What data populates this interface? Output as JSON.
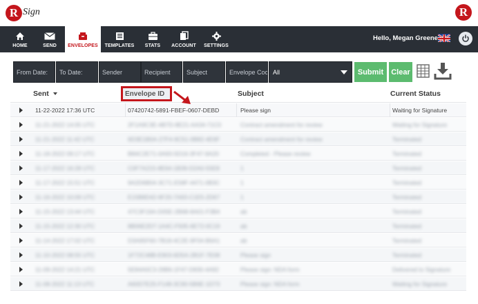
{
  "brand": {
    "logo_letter": "R",
    "logo_text": "Sign",
    "color": "#c4161c"
  },
  "nav": {
    "items": [
      {
        "label": "HOME",
        "icon": "home-icon"
      },
      {
        "label": "SEND",
        "icon": "envelope-icon"
      },
      {
        "label": "ENVELOPES",
        "icon": "envelopes-icon"
      },
      {
        "label": "TEMPLATES",
        "icon": "templates-icon"
      },
      {
        "label": "STATS",
        "icon": "briefcase-icon"
      },
      {
        "label": "ACCOUNT",
        "icon": "account-icon"
      },
      {
        "label": "SETTINGS",
        "icon": "gear-icon"
      }
    ],
    "active": "ENVELOPES",
    "greeting": "Hello, Megan Greene"
  },
  "filters": {
    "from_date": "From Date:",
    "to_date": "To Date:",
    "sender": "Sender",
    "recipient": "Recipient",
    "subject": "Subject",
    "envelope_code": "Envelope Coc",
    "status_select": "All",
    "submit": "Submit",
    "clear": "Clear"
  },
  "table": {
    "columns": {
      "sent": "Sent",
      "envelope_id": "Envelope ID",
      "subject": "Subject",
      "status": "Current Status"
    },
    "first_row": {
      "sent": "11-22-2022 17:36 UTC",
      "envelope_id": "07420742-5891-FBEF-0607-DEBD",
      "subject": "Please sign",
      "status": "Waiting for Signature"
    },
    "blurred_rows": [
      {
        "sent": "11-21-2022 14:05 UTC",
        "envelope_id": "2F1A9C3E-4B7D-8E21-AA34-71C0",
        "subject": "Contract amendment for review",
        "status": "Waiting for Signature"
      },
      {
        "sent": "11-21-2022 11:42 UTC",
        "envelope_id": "6D3E1B0A-27F4-9C51-0B82-4E6F",
        "subject": "Contract amendment for review",
        "status": "Terminated"
      },
      {
        "sent": "11-18-2022 09:17 UTC",
        "envelope_id": "B84C2E71-0A93-5D16-3F47-9A20",
        "subject": "Completed - Please review",
        "status": "Terminated"
      },
      {
        "sent": "11-17-2022 16:28 UTC",
        "envelope_id": "C0F7A215-8E64-1B39-D2A0-55E8",
        "subject": "1",
        "status": "Terminated"
      },
      {
        "sent": "11-17-2022 15:51 UTC",
        "envelope_id": "9A2D6B04-3C71-E58F-4471-0B3C",
        "subject": "1",
        "status": "Terminated"
      },
      {
        "sent": "11-16-2022 10:09 UTC",
        "envelope_id": "E15B8D42-6F20-7A93-C1E5-2D67",
        "subject": "1",
        "status": "Terminated"
      },
      {
        "sent": "11-15-2022 13:44 UTC",
        "envelope_id": "47C3F19A-D05E-2B68-8A01-F3B4",
        "subject": "ab",
        "status": "Terminated"
      },
      {
        "sent": "11-15-2022 12:30 UTC",
        "envelope_id": "8B06E2D7-1A4C-F935-6E72-0C19",
        "subject": "ab",
        "status": "Terminated"
      },
      {
        "sent": "11-14-2022 17:02 UTC",
        "envelope_id": "D3A95F60-7B18-4C2E-9F04-B6A1",
        "subject": "ab",
        "status": "Terminated"
      },
      {
        "sent": "11-10-2022 08:55 UTC",
        "envelope_id": "1F72C48B-E903-6D5A-2B1F-7E08",
        "subject": "Please sign",
        "status": "Terminated"
      },
      {
        "sent": "11-09-2022 14:21 UTC",
        "envelope_id": "5E84A0C3-29B6-1F47-D830-4A92",
        "subject": "Please sign: NDA form",
        "status": "Delivered to Signature"
      },
      {
        "sent": "11-08-2022 11:13 UTC",
        "envelope_id": "A60D7E25-F148-3C90-5B6E-1D73",
        "subject": "Please sign: NDA form",
        "status": "Waiting for Signature"
      }
    ]
  }
}
